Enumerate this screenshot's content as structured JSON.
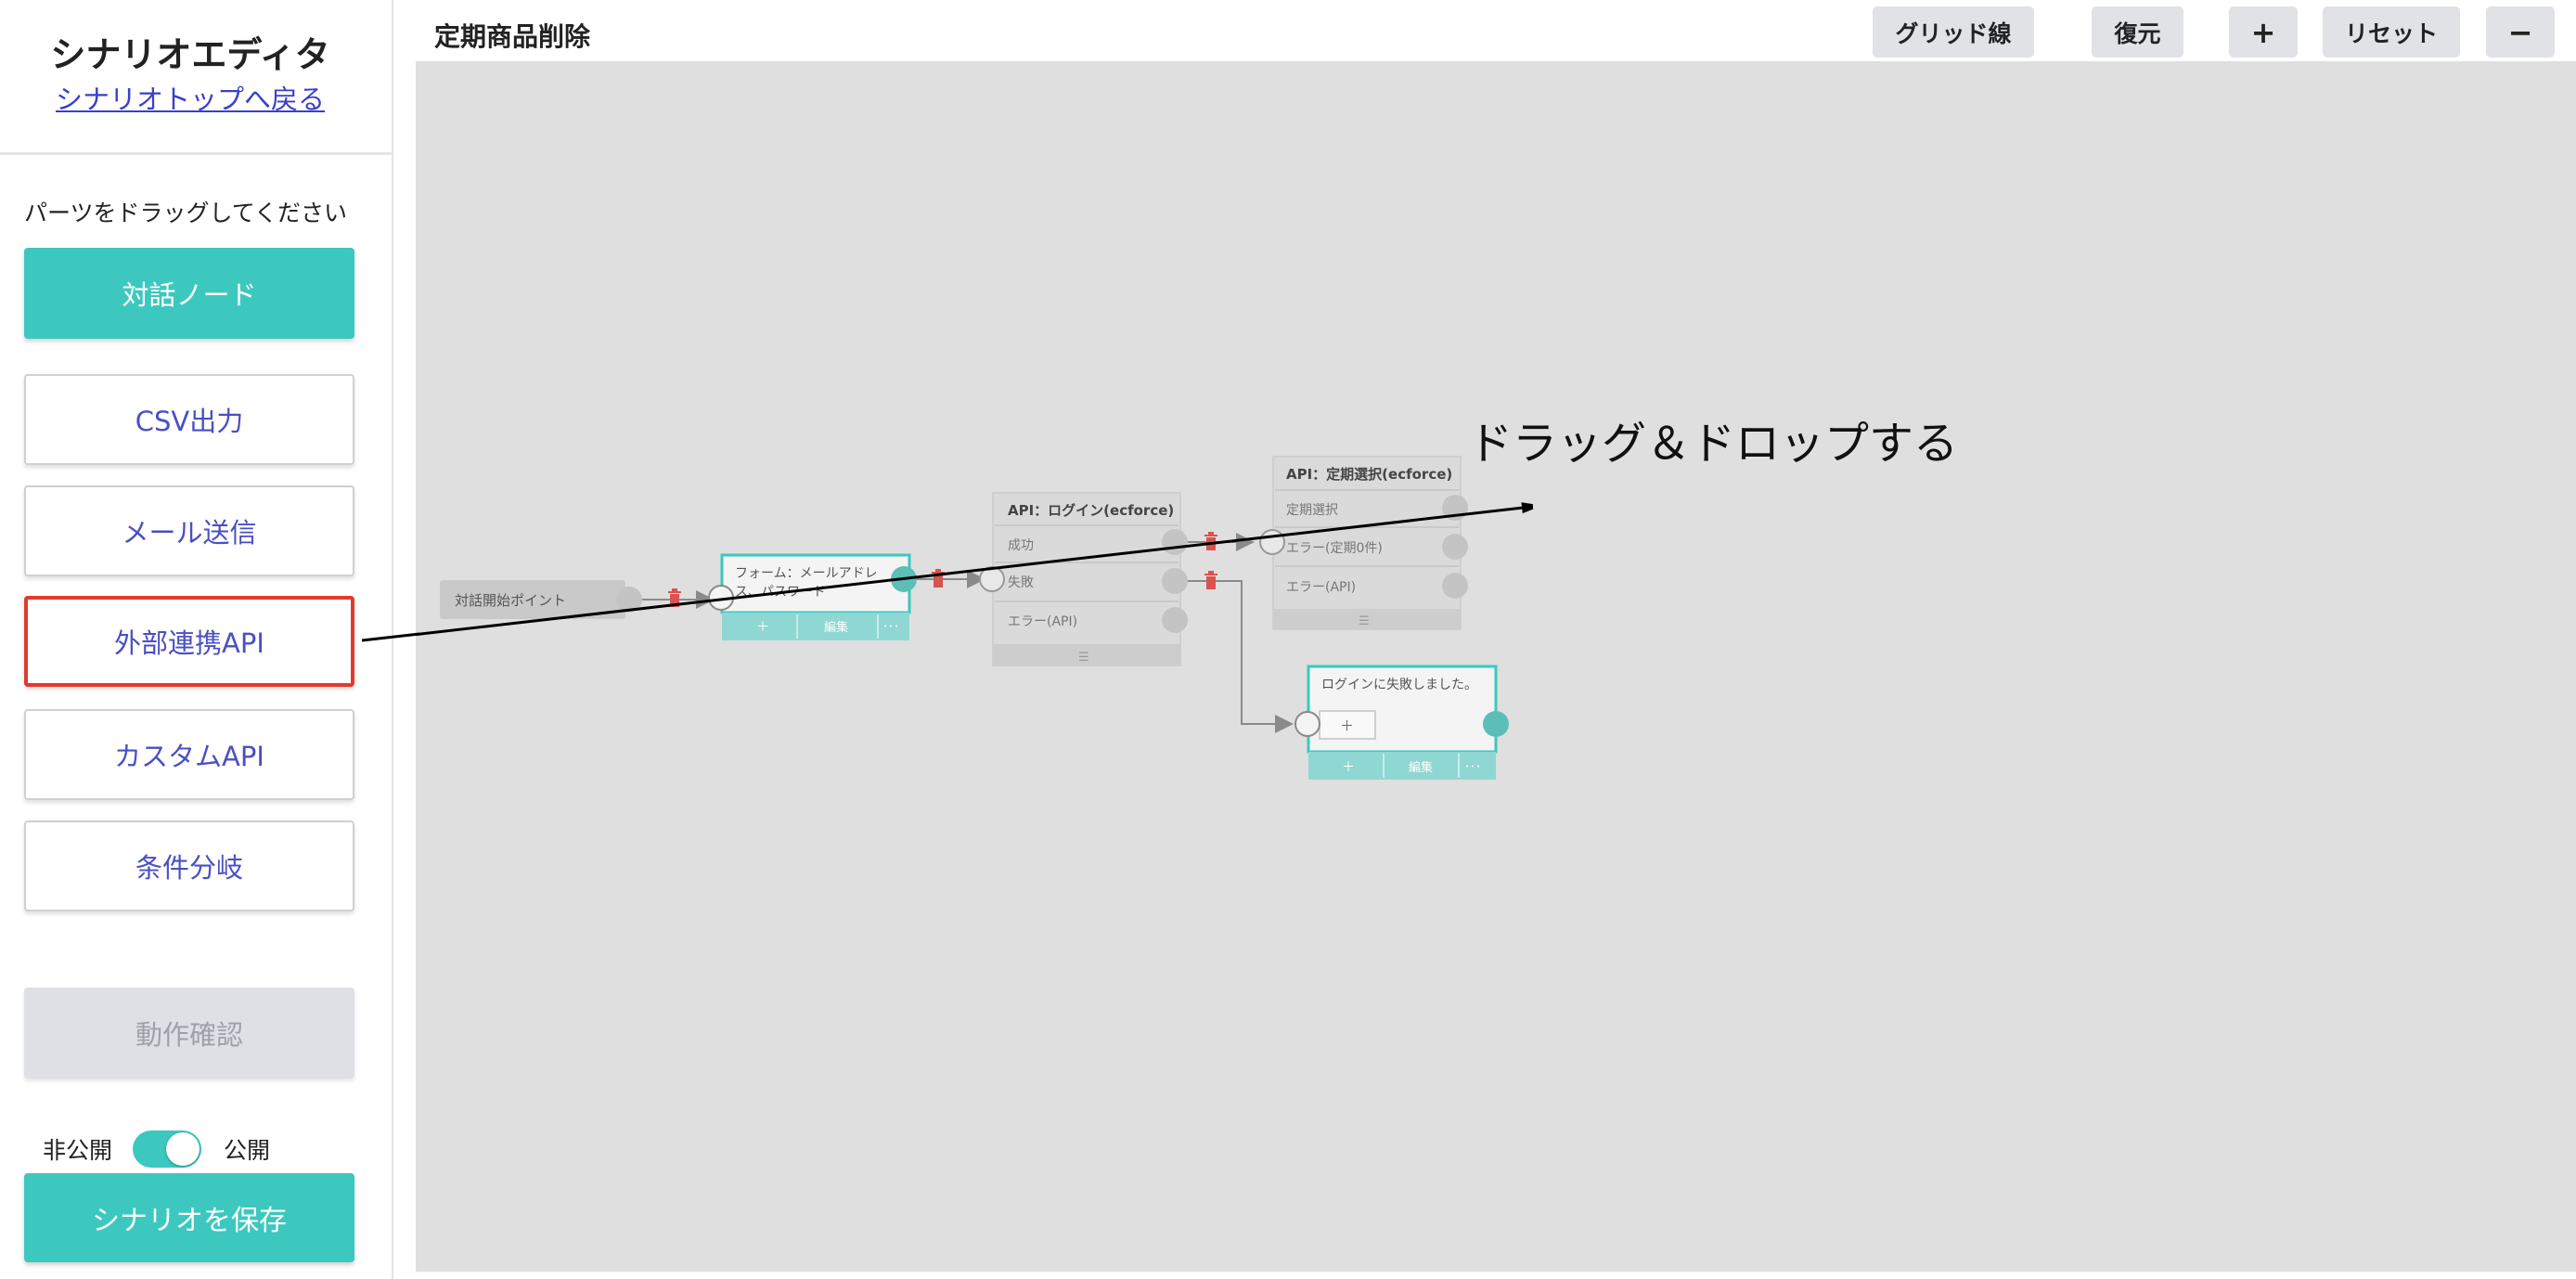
{
  "sidebar": {
    "title": "シナリオエディタ",
    "back_link": "シナリオトップへ戻る",
    "hint": "パーツをドラッグしてください",
    "parts": [
      {
        "label": "対話ノード"
      },
      {
        "label": "CSV出力"
      },
      {
        "label": "メール送信"
      },
      {
        "label": "外部連携API"
      },
      {
        "label": "カスタムAPI"
      },
      {
        "label": "条件分岐"
      }
    ],
    "test_button": "動作確認",
    "toggle": {
      "off_label": "非公開",
      "on_label": "公開",
      "state": "on"
    },
    "save_button": "シナリオを保存"
  },
  "header": {
    "title": "定期商品削除",
    "buttons": {
      "grid": "グリッド線",
      "restore": "復元",
      "zoom_in": "+",
      "reset": "リセット",
      "zoom_out": "−"
    }
  },
  "canvas": {
    "annotation": "ドラッグ＆ドロップする",
    "nodes": {
      "start": {
        "label": "対話開始ポイント"
      },
      "form": {
        "title": "フォーム：メールアドレス、パスワード",
        "title_line1": "フォーム：メールアドレ",
        "title_line2": "ス、パスワード",
        "add": "＋",
        "edit": "編集",
        "more": "･･･"
      },
      "api_login": {
        "title": "API：ログイン(ecforce)",
        "outputs": [
          "成功",
          "失敗",
          "エラー(API)"
        ],
        "footer": "☰"
      },
      "api_select": {
        "title": "API：定期選択(ecforce)",
        "outputs": [
          "定期選択",
          "エラー(定期0件)",
          "エラー(API)"
        ],
        "footer": "☰"
      },
      "fail_msg": {
        "title": "ログインに失敗しました。",
        "inner_add": "＋",
        "add": "＋",
        "edit": "編集",
        "more": "･･･"
      }
    }
  },
  "colors": {
    "teal": "#3cc8bf",
    "link": "#3b3fc8",
    "part_text": "#4a4fc3",
    "highlight_border": "#e23a2f",
    "canvas_bg": "#dfdfdf",
    "delete_icon": "#d9534f"
  }
}
